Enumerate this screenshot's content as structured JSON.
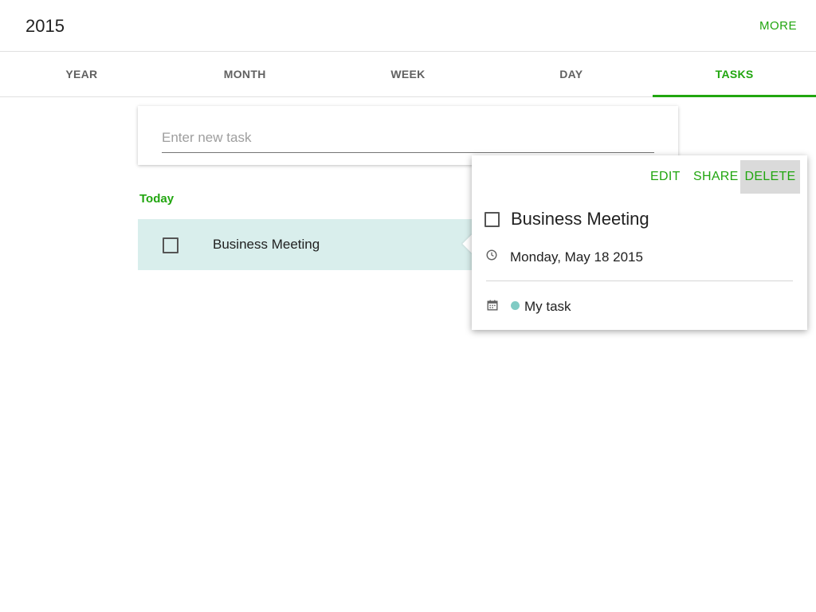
{
  "header": {
    "title": "2015",
    "more_label": "MORE"
  },
  "tabs": [
    {
      "label": "YEAR",
      "active": false
    },
    {
      "label": "MONTH",
      "active": false
    },
    {
      "label": "WEEK",
      "active": false
    },
    {
      "label": "DAY",
      "active": false
    },
    {
      "label": "TASKS",
      "active": true
    }
  ],
  "new_task": {
    "placeholder": "Enter new task",
    "value": ""
  },
  "sections": [
    {
      "header": "Today",
      "tasks": [
        {
          "label": "Business Meeting",
          "checked": false
        }
      ]
    }
  ],
  "popup": {
    "actions": {
      "edit": "EDIT",
      "share": "SHARE",
      "delete": "DELETE"
    },
    "title": "Business Meeting",
    "checked": false,
    "date": "Monday, May 18 2015",
    "task_list": "My task",
    "task_list_color": "#80cbc4"
  },
  "colors": {
    "accent": "#21a60f",
    "selected_row": "#d9eeec",
    "pressed_button": "#dadada"
  },
  "icons": {
    "date": "clock-icon",
    "list": "calendar-icon"
  }
}
